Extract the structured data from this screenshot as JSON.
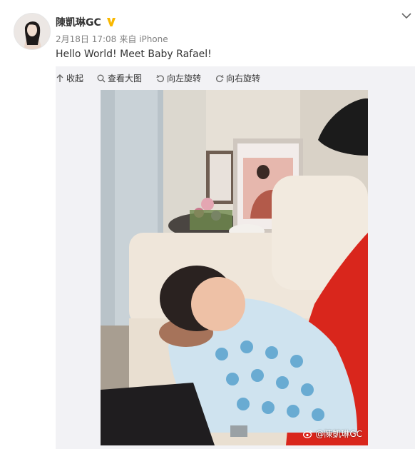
{
  "post": {
    "username": "陳凱琳GC",
    "date": "2月18日 17:08",
    "source": "来自 iPhone",
    "text": "Hello World! Meet Baby Rafael!"
  },
  "toolbar": {
    "collapse": "收起",
    "view_large": "查看大图",
    "rotate_left": "向左旋转",
    "rotate_right": "向右旋转"
  },
  "watermark": "@陳凱琳GC",
  "colors": {
    "verified_badge": "#f9b800",
    "toolbar_bg": "#f2f2f5",
    "text_gray": "#808080"
  }
}
